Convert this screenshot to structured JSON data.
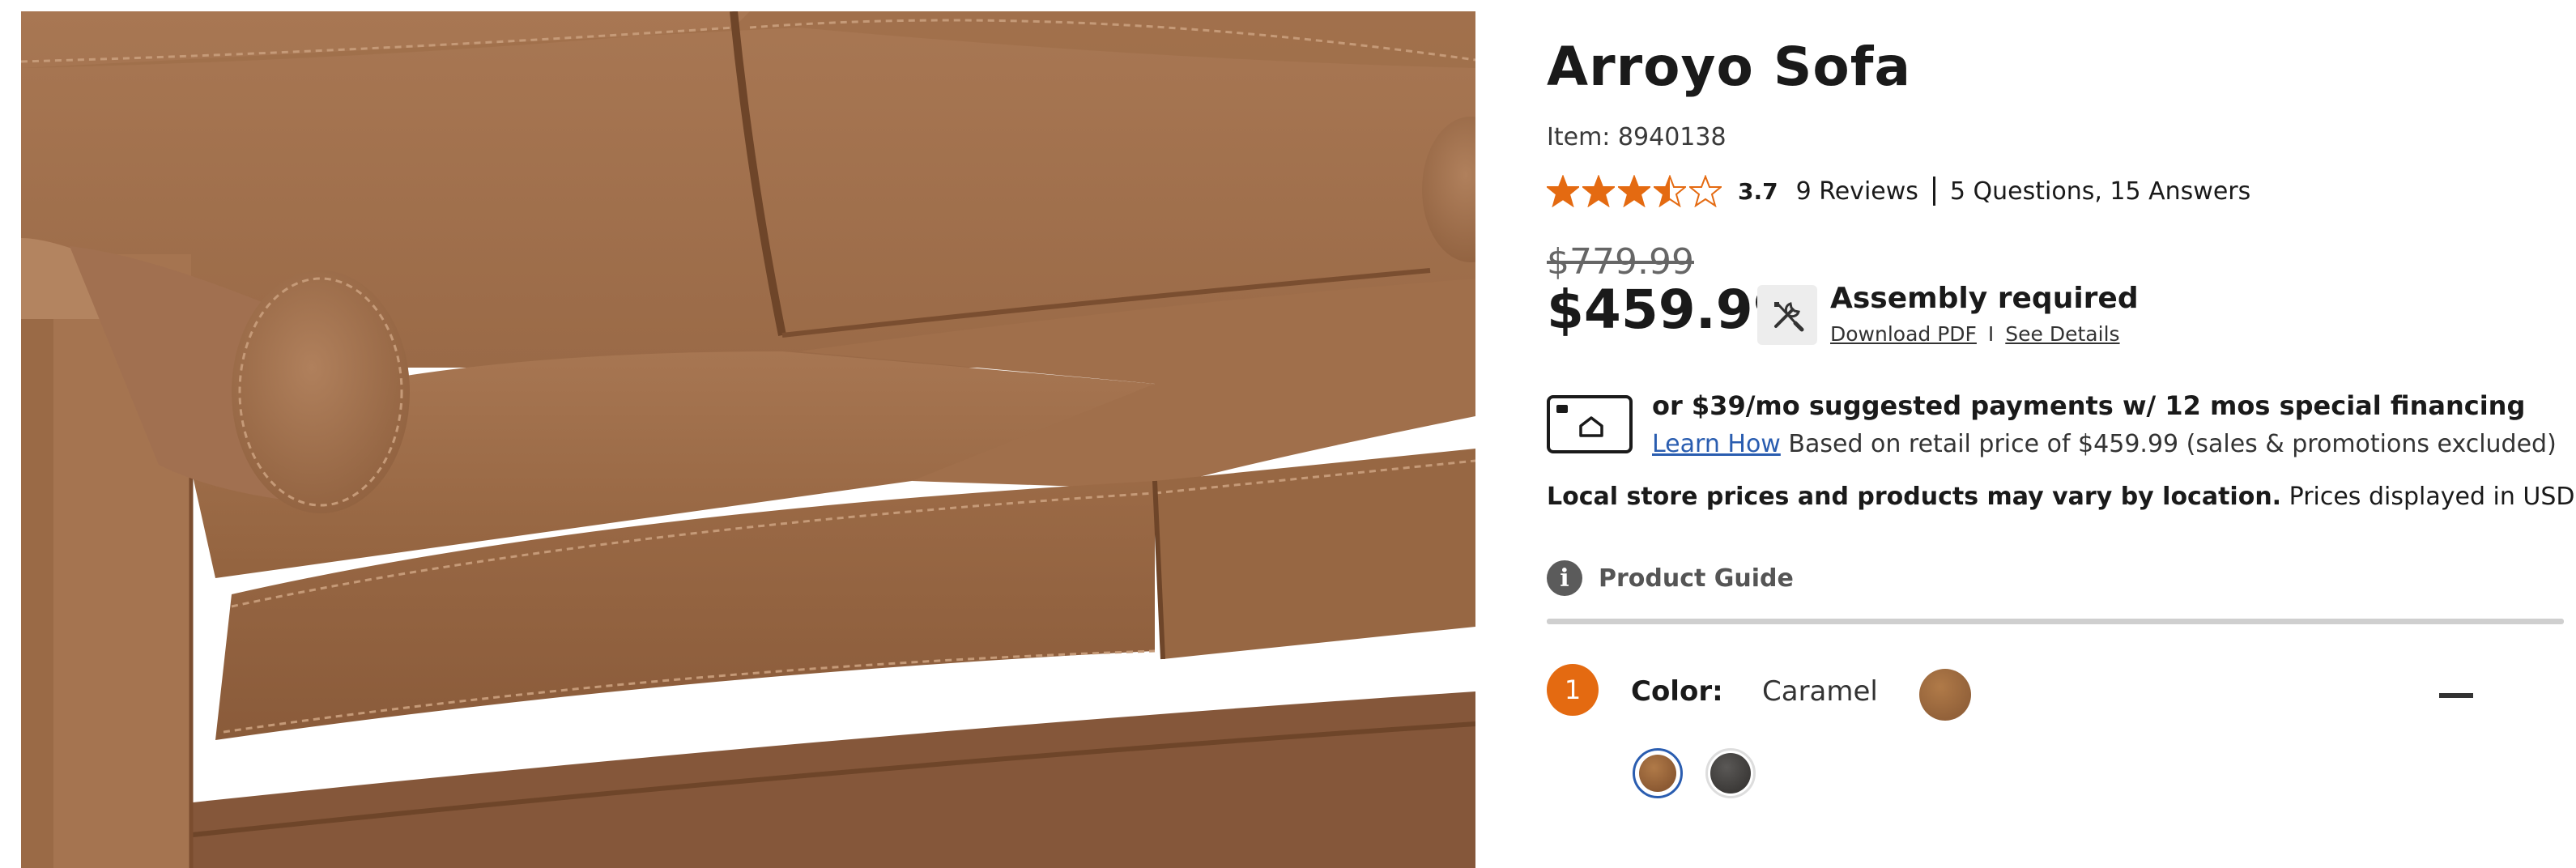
{
  "product": {
    "title": "Arroyo Sofa",
    "item_label": "Item: 8940138",
    "image_alt": "Arroyo Sofa in caramel faux leather"
  },
  "rating": {
    "value": "3.7",
    "stars_filled": 3.5,
    "stars_total": 5,
    "star_color": "#e46a11",
    "reviews": "9 Reviews",
    "questions": "5 Questions, 15 Answers"
  },
  "pricing": {
    "original": "$779.99",
    "current": "$459.99"
  },
  "assembly": {
    "title": "Assembly required",
    "download_pdf": "Download PDF",
    "separator": "I",
    "see_details": "See Details",
    "icon": "tools-icon"
  },
  "financing": {
    "bold_text": "or $39/mo suggested payments w/ 12 mos special financing",
    "learn_how": "Learn How",
    "note": "Based on retail price of $459.99 (sales & promotions excluded)",
    "icon": "credit-card-icon"
  },
  "local_note": {
    "bold": "Local store prices and products may vary by location.",
    "rest": "Prices displayed in USD only."
  },
  "product_guide": {
    "label": "Product Guide",
    "icon": "info-icon"
  },
  "color_step": {
    "step": "1",
    "label": "Color:",
    "value": "Caramel",
    "accent": "#e46a11",
    "swatches": [
      {
        "name": "Caramel",
        "color": "#9a653b",
        "selected": true
      },
      {
        "name": "Charcoal",
        "color": "#45423f",
        "selected": false
      }
    ]
  }
}
